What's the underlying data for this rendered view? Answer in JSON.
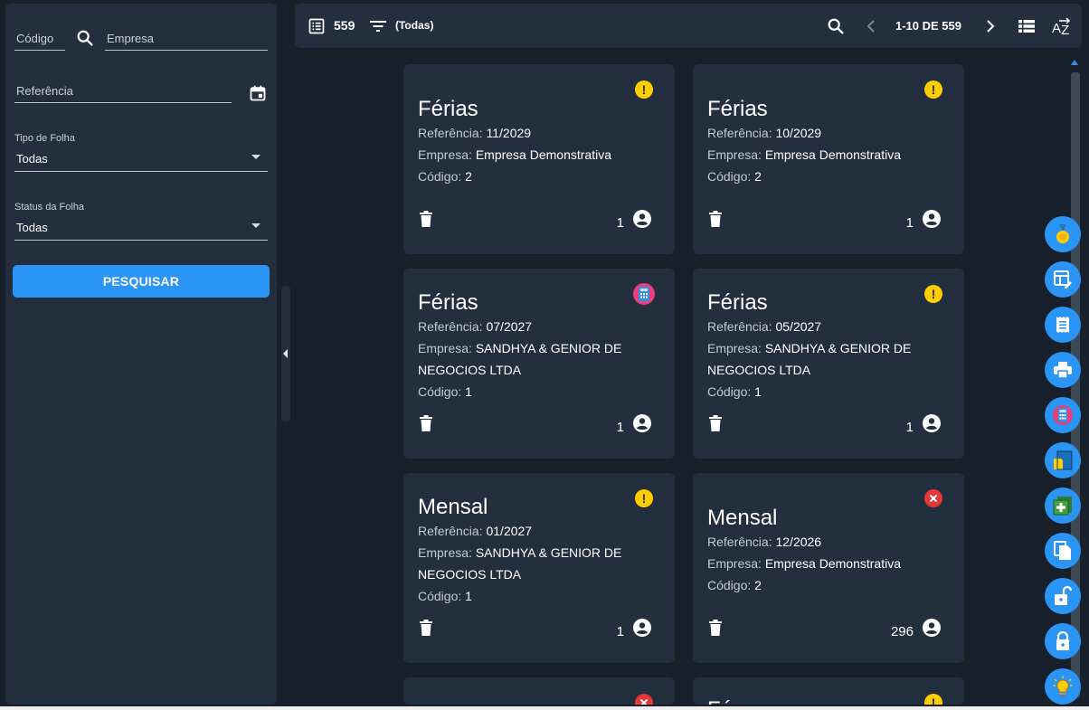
{
  "sidebar": {
    "codigo_placeholder": "Código",
    "empresa_placeholder": "Empresa",
    "referencia_placeholder": "Referência",
    "tipo_folha": {
      "label": "Tipo de Folha",
      "value": "Todas"
    },
    "status_folha": {
      "label": "Status da Folha",
      "value": "Todas"
    },
    "search_button": "PESQUISAR"
  },
  "toolbar": {
    "total_count": "559",
    "filter_label": "(Todas)",
    "pagination": "1-10 DE 559"
  },
  "labels": {
    "referencia": "Referência: ",
    "empresa": "Empresa: ",
    "codigo": "Código: "
  },
  "cards": [
    {
      "title": "Férias",
      "referencia": "11/2029",
      "empresa": "Empresa Demonstrativa",
      "codigo": "2",
      "count": "1",
      "status_icon": "warning-icon"
    },
    {
      "title": "Férias",
      "referencia": "10/2029",
      "empresa": "Empresa Demonstrativa",
      "codigo": "2",
      "count": "1",
      "status_icon": "warning-icon"
    },
    {
      "title": "Férias",
      "referencia": "07/2027",
      "empresa": "SANDHYA & GENIOR DE NEGOCIOS LTDA",
      "codigo": "1",
      "count": "1",
      "status_icon": "calculator-status-icon"
    },
    {
      "title": "Férias",
      "referencia": "05/2027",
      "empresa": "SANDHYA & GENIOR DE NEGOCIOS LTDA",
      "codigo": "1",
      "count": "1",
      "status_icon": "warning-icon"
    },
    {
      "title": "Mensal",
      "referencia": "01/2027",
      "empresa": "SANDHYA & GENIOR DE NEGOCIOS LTDA",
      "codigo": "1",
      "count": "1",
      "status_icon": "warning-icon"
    },
    {
      "title": "Mensal",
      "referencia": "12/2026",
      "empresa": "Empresa Demonstrativa",
      "codigo": "2",
      "count": "296",
      "status_icon": "error-icon"
    },
    {
      "title": "",
      "status_icon": "error-icon"
    },
    {
      "title": "Fé",
      "status_icon": "warning-icon"
    }
  ],
  "fabs": [
    "medal-icon",
    "table-edit-icon",
    "receipt-icon",
    "print-icon",
    "calculator-icon",
    "folder-icon",
    "add-box-icon",
    "copy-icon",
    "unlock-icon",
    "lock-icon",
    "lightbulb-icon"
  ],
  "colors": {
    "background": "#18202b",
    "panel": "#232f3f",
    "accent": "#2b95f5",
    "warning": "#ffcc00",
    "error": "#e53935"
  }
}
